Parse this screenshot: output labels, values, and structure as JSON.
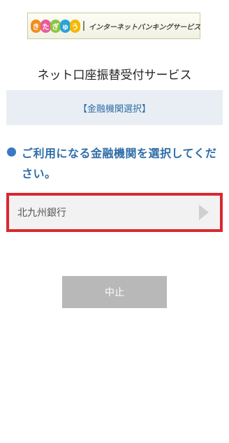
{
  "logo": {
    "bubbles": [
      {
        "char": "き",
        "color": "#f08c1e"
      },
      {
        "char": "た",
        "color": "#e85a9a"
      },
      {
        "char": "ぎ",
        "color": "#8cc63f"
      },
      {
        "char": "ゅ",
        "color": "#29a3dc"
      },
      {
        "char": "う",
        "color": "#f5b800"
      }
    ],
    "text": "インターネットバンキングサービス"
  },
  "header": {
    "title": "ネット口座振替受付サービス"
  },
  "section": {
    "label": "【金融機関選択】"
  },
  "instruction": {
    "text": "ご利用になる金融機関を選択してください。"
  },
  "bank_list": {
    "items": [
      {
        "label": "北九州銀行"
      }
    ]
  },
  "actions": {
    "cancel_label": "中止"
  },
  "colors": {
    "accent_blue": "#2f6da8",
    "highlight_red": "#d9282f",
    "button_gray": "#b8b8b8",
    "section_bg": "#e8eef3"
  }
}
